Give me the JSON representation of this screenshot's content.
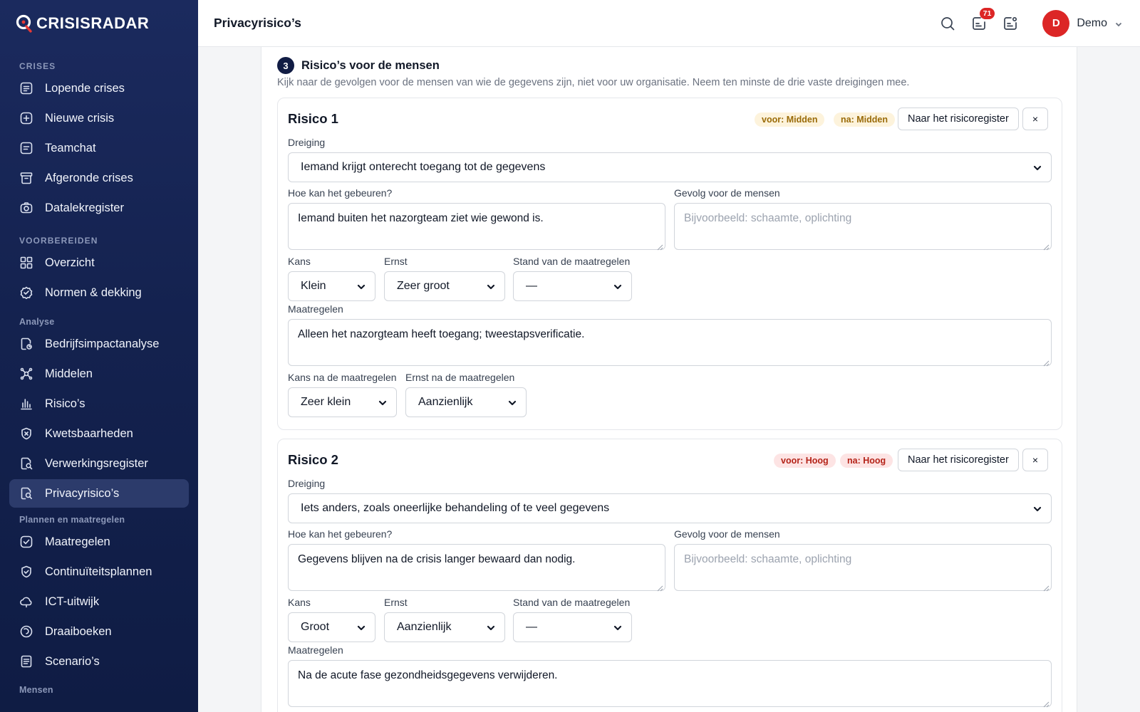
{
  "app": {
    "brand": "CRISISRADAR",
    "page_title": "Privacyrisico’s"
  },
  "sidebar": {
    "sections": {
      "crises": "CRISES",
      "voorbereiden": "VOORBEREIDEN",
      "analyse": "Analyse",
      "plannen": "Plannen en maatregelen",
      "mensen": "Mensen"
    },
    "items": [
      {
        "label": "Lopende crises",
        "icon": "list-icon"
      },
      {
        "label": "Nieuwe crisis",
        "icon": "plus-square-icon"
      },
      {
        "label": "Teamchat",
        "icon": "chat-icon"
      },
      {
        "label": "Afgeronde crises",
        "icon": "archive-icon"
      },
      {
        "label": "Datalekregister",
        "icon": "camera-icon"
      },
      {
        "label": "Overzicht",
        "icon": "grid-icon"
      },
      {
        "label": "Normen & dekking",
        "icon": "badge-check-icon"
      },
      {
        "label": "Bedrijfsimpactanalyse",
        "icon": "document-chart-icon"
      },
      {
        "label": "Middelen",
        "icon": "network-icon"
      },
      {
        "label": "Risico’s",
        "icon": "bar-chart-icon"
      },
      {
        "label": "Kwetsbaarheden",
        "icon": "shield-x-icon"
      },
      {
        "label": "Verwerkingsregister",
        "icon": "document-search-icon"
      },
      {
        "label": "Privacyrisico’s",
        "icon": "document-magnify-icon",
        "active": true
      },
      {
        "label": "Maatregelen",
        "icon": "check-square-icon"
      },
      {
        "label": "Continuïteitsplannen",
        "icon": "shield-check-icon"
      },
      {
        "label": "ICT-uitwijk",
        "icon": "cloud-icon"
      },
      {
        "label": "Draaiboeken",
        "icon": "book-icon"
      },
      {
        "label": "Scenario’s",
        "icon": "doc-lines-icon"
      }
    ]
  },
  "topbar": {
    "notifications_count": "71",
    "user_initial": "D",
    "user_name": "Demo"
  },
  "step": {
    "number": "3",
    "title": "Risico’s voor de mensen",
    "description": "Kijk naar de gevolgen voor de mensen van wie de gegevens zijn, niet voor uw organisatie. Neem ten minste de drie vaste dreigingen mee."
  },
  "labels": {
    "dreiging": "Dreiging",
    "hoe": "Hoe kan het gebeuren?",
    "gevolg": "Gevolg voor de mensen",
    "kans": "Kans",
    "ernst": "Ernst",
    "stand": "Stand van de maatregelen",
    "maatregelen": "Maatregelen",
    "kans_na": "Kans na de maatregelen",
    "ernst_na": "Ernst na de maatregelen",
    "register_button": "Naar het risicoregister",
    "close": "×",
    "gevolg_placeholder": "Bijvoorbeeld: schaamte, oplichting"
  },
  "risks": [
    {
      "title": "Risico 1",
      "voor": "voor: Midden",
      "na": "na: Midden",
      "dreiging": "Iemand krijgt onterecht toegang tot de gegevens",
      "hoe": "Iemand buiten het nazorgteam ziet wie gewond is.",
      "gevolg": "",
      "kans": "Klein",
      "ernst": "Zeer groot",
      "stand": "—",
      "maatregelen": "Alleen het nazorgteam heeft toegang; tweestapsverificatie.",
      "kans_na": "Zeer klein",
      "ernst_na": "Aanzienlijk"
    },
    {
      "title": "Risico 2",
      "voor": "voor: Hoog",
      "na": "na: Hoog",
      "dreiging": "Iets anders, zoals oneerlijke behandeling of te veel gegevens",
      "hoe": "Gegevens blijven na de crisis langer bewaard dan nodig.",
      "gevolg": "",
      "kans": "Groot",
      "ernst": "Aanzienlijk",
      "stand": "—",
      "maatregelen": "Na de acute fase gezondheidsgegevens verwijderen."
    }
  ],
  "colors": {
    "sidebar_bg": "#1b2a5e",
    "accent_red": "#dc2626",
    "pill_mid_bg": "#fdf3dc",
    "pill_high_bg": "#fde4e4"
  }
}
